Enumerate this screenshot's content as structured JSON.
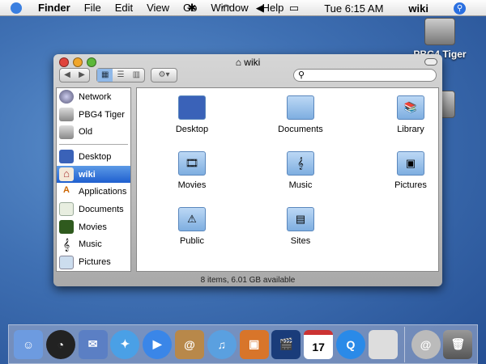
{
  "menubar": {
    "app": "Finder",
    "items": [
      "File",
      "Edit",
      "View",
      "Go",
      "Window",
      "Help"
    ],
    "clock": "Tue 6:15 AM",
    "user": "wiki"
  },
  "desktop": {
    "icons": [
      "PBG4 Tiger"
    ]
  },
  "window": {
    "title": "wiki",
    "status": "8 items, 6.01 GB available",
    "search_placeholder": "",
    "sidebar": {
      "devices": [
        "Network",
        "PBG4 Tiger",
        "Old"
      ],
      "places": [
        "Desktop",
        "wiki",
        "Applications",
        "Documents",
        "Movies",
        "Music",
        "Pictures"
      ],
      "selected": "wiki"
    },
    "items": [
      "Desktop",
      "Documents",
      "Library",
      "Movies",
      "Music",
      "Pictures",
      "Public",
      "Sites"
    ]
  },
  "dock": [
    "Finder",
    "Dashboard",
    "Mail",
    "Safari",
    "iChat",
    "Address Book",
    "iTunes",
    "iPhoto",
    "iMovie",
    "iCal",
    "QuickTime Player",
    "System Preferences",
    "Downloads",
    "Trash"
  ],
  "colors": {
    "selection": "#2f6fd6",
    "folder": "#9cc4ec"
  }
}
